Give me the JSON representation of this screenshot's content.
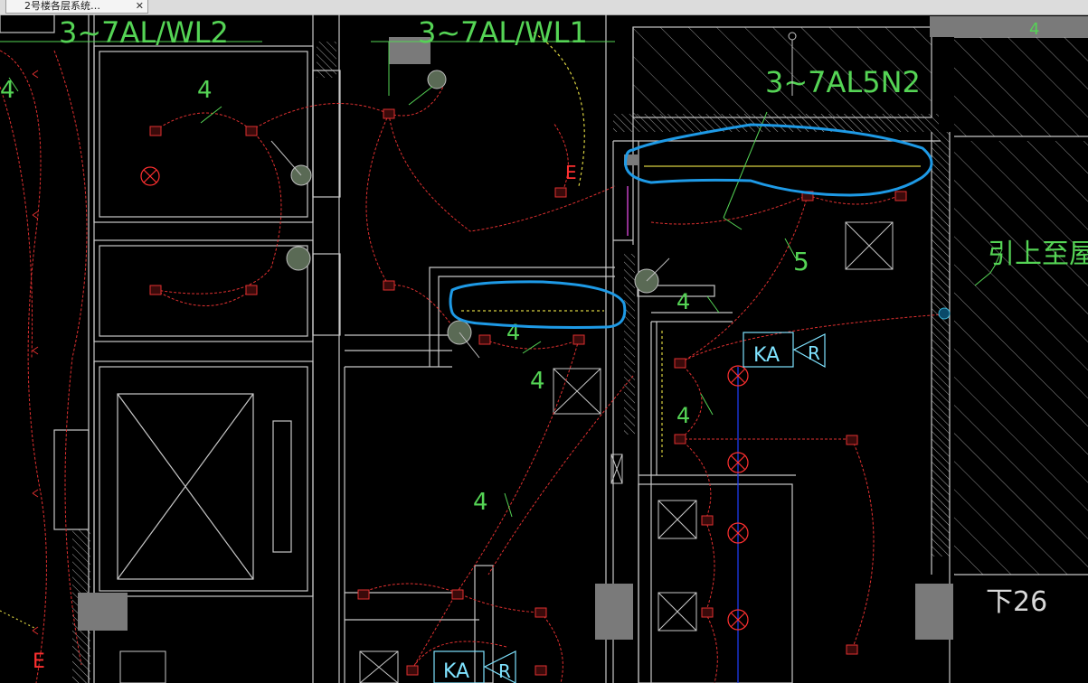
{
  "window": {
    "tab_title": "2号楼各层系统…",
    "close_glyph": "✕"
  },
  "drawing": {
    "circuit_labels": {
      "wl2": "3~7AL/WL2",
      "wl1": "3~7AL/WL1",
      "top_right": "3~7AL5N2"
    },
    "riser_note": "引上至屋",
    "ka_label": "KA",
    "r_label": "R",
    "count_labels": [
      "4",
      "4",
      "5",
      "4",
      "4",
      "4",
      "4",
      "4",
      "4"
    ],
    "e_label": "E",
    "elevation_label": "下26"
  },
  "colors": {
    "background": "#000000",
    "wall": "#c8c8c8",
    "wire": "#e03030",
    "text_green": "#55d455",
    "markup_blue": "#1e9ae6",
    "device_cyan": "#7fe3ff",
    "bus_blue": "#2040ff",
    "hatch": "#8a8a8a"
  }
}
